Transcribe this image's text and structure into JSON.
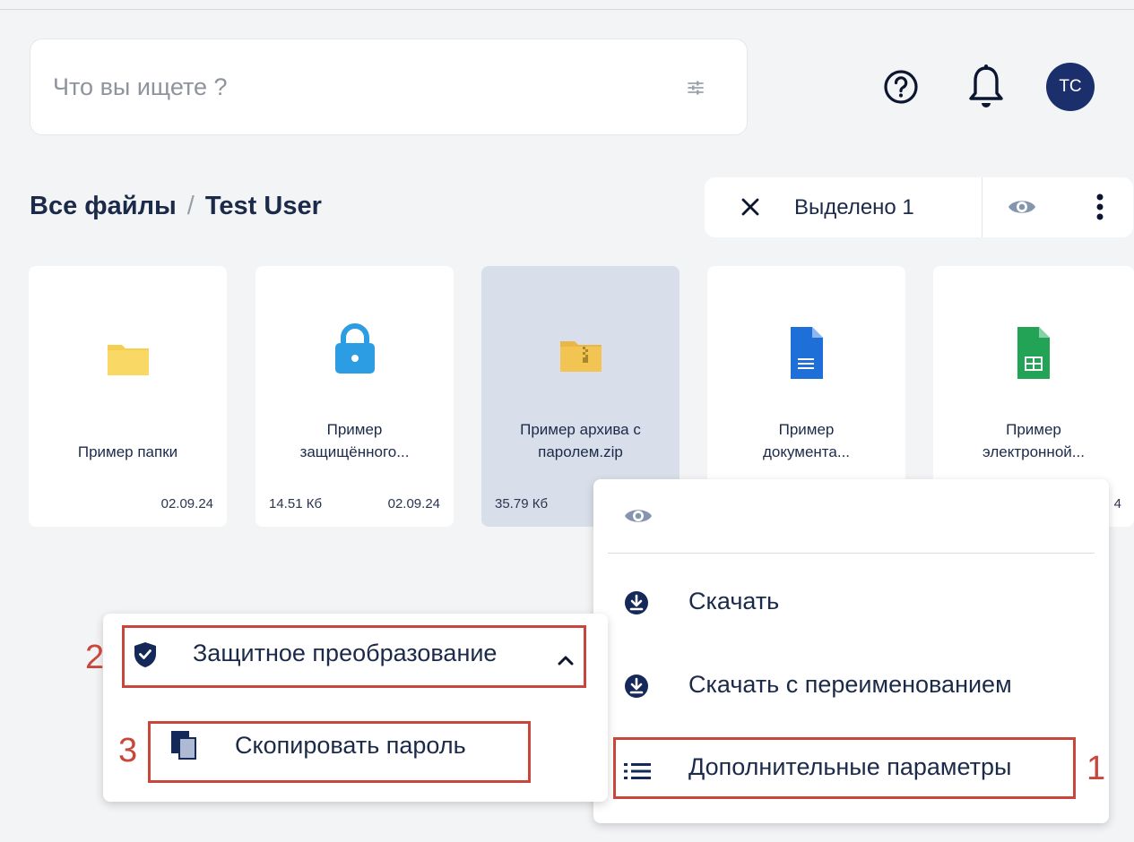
{
  "search": {
    "placeholder": "Что вы ищете ?"
  },
  "header": {
    "help_icon": "help-circle-icon",
    "bell_icon": "bell-icon",
    "avatar_initials": "TC"
  },
  "breadcrumb": {
    "root": "Все файлы",
    "separator": "/",
    "current": "Test User"
  },
  "selection_bar": {
    "count_label": "Выделено 1"
  },
  "files": [
    {
      "name_line1": "Пример папки",
      "name_line2": "",
      "size": "",
      "date": "02.09.24",
      "icon": "folder-icon"
    },
    {
      "name_line1": "Пример",
      "name_line2": "защищённого...",
      "size": "14.51 Кб",
      "date": "02.09.24",
      "icon": "lock-icon"
    },
    {
      "name_line1": "Пример архива с",
      "name_line2": "паролем.zip",
      "size": "35.79 Кб",
      "date": "",
      "icon": "zip-folder-icon"
    },
    {
      "name_line1": "Пример",
      "name_line2": "документа...",
      "size": "",
      "date": "",
      "icon": "document-icon"
    },
    {
      "name_line1": "Пример",
      "name_line2": "электронной...",
      "size": "",
      "date": "4",
      "icon": "spreadsheet-icon"
    }
  ],
  "context_menu": {
    "download": "Скачать",
    "download_rename": "Скачать с переименованием",
    "more_params": "Дополнительные параметры"
  },
  "submenu": {
    "protective": "Защитное преобразование",
    "copy_password": "Скопировать пароль"
  },
  "annotations": {
    "n1": "1",
    "n2": "2",
    "n3": "3"
  },
  "colors": {
    "accent": "#1a2f6c",
    "highlight": "#c9463d",
    "selected_card": "#d9dfea"
  }
}
